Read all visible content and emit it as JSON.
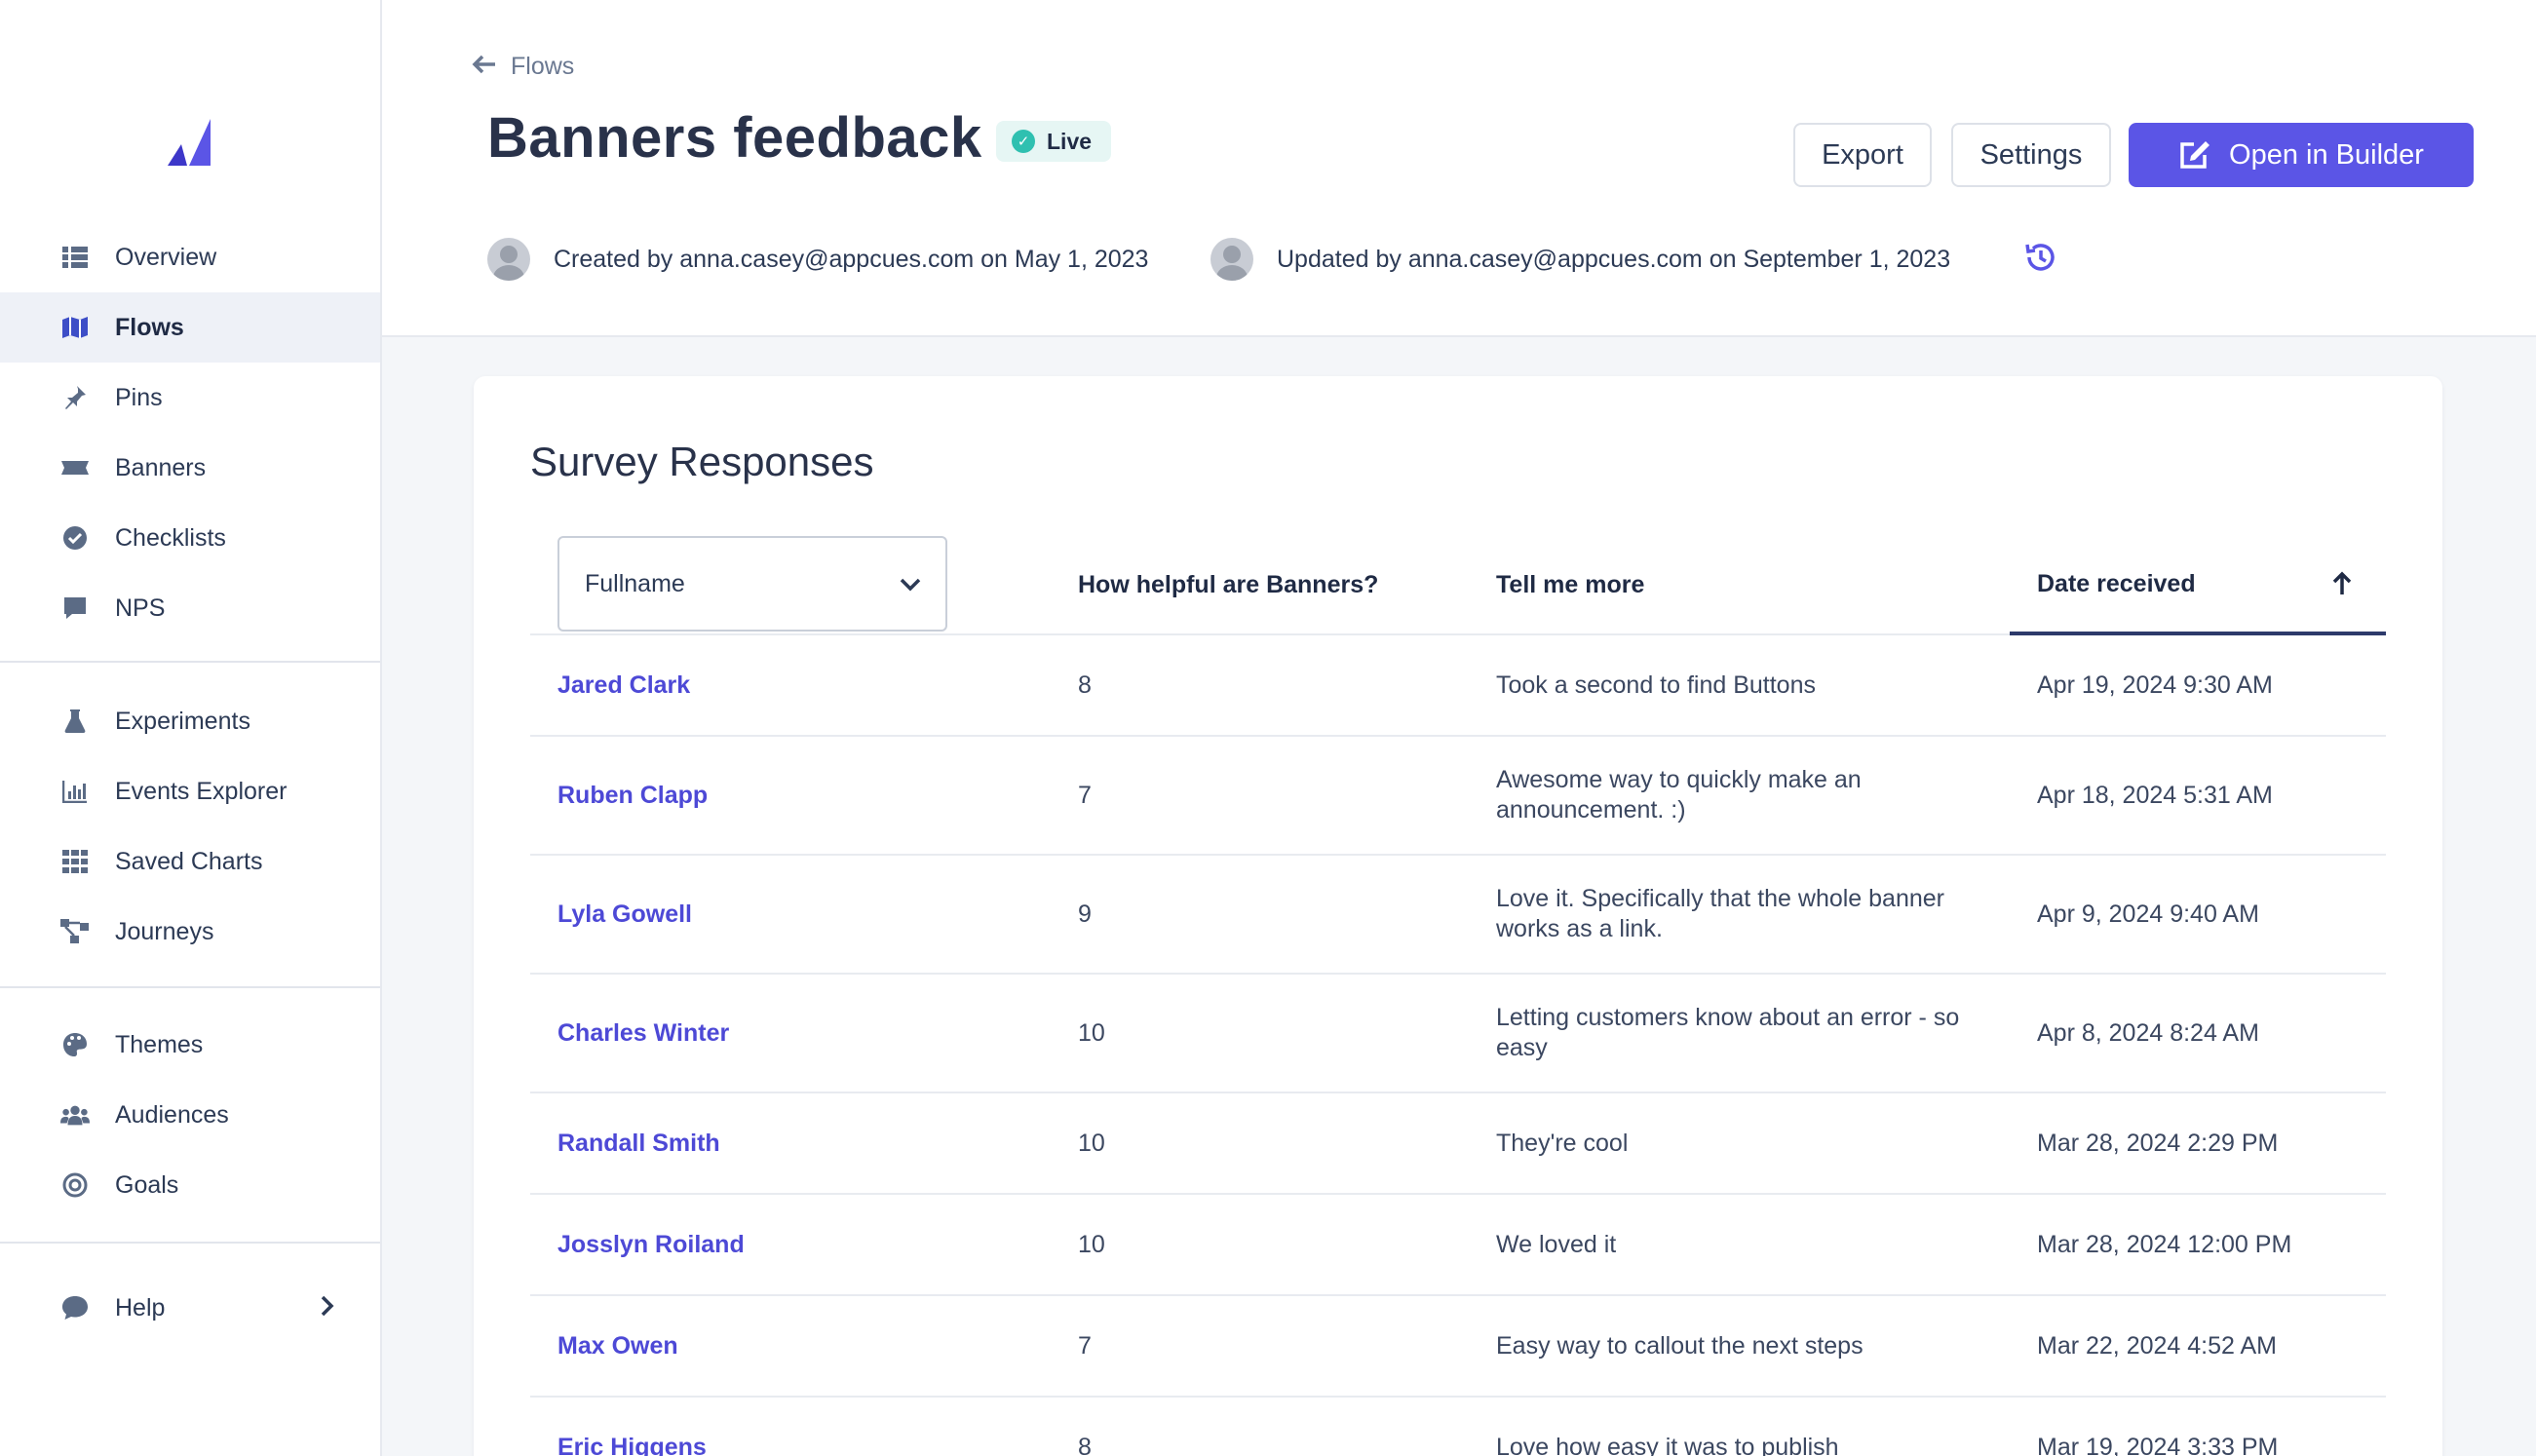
{
  "brand": {
    "accent": "#5b55e6",
    "link": "#4d49d6"
  },
  "sidebar": {
    "groups": [
      [
        {
          "label": "Overview",
          "icon": "list-icon"
        },
        {
          "label": "Flows",
          "icon": "map-icon",
          "active": true
        },
        {
          "label": "Pins",
          "icon": "pin-icon"
        },
        {
          "label": "Banners",
          "icon": "banner-icon"
        },
        {
          "label": "Checklists",
          "icon": "check-circle-icon"
        },
        {
          "label": "NPS",
          "icon": "chat-icon"
        }
      ],
      [
        {
          "label": "Experiments",
          "icon": "flask-icon"
        },
        {
          "label": "Events Explorer",
          "icon": "bar-chart-icon"
        },
        {
          "label": "Saved Charts",
          "icon": "grid-icon"
        },
        {
          "label": "Journeys",
          "icon": "journey-icon"
        }
      ],
      [
        {
          "label": "Themes",
          "icon": "palette-icon"
        },
        {
          "label": "Audiences",
          "icon": "users-icon"
        },
        {
          "label": "Goals",
          "icon": "target-icon"
        }
      ]
    ],
    "help": {
      "label": "Help",
      "icon": "comment-icon"
    }
  },
  "header": {
    "breadcrumb": "Flows",
    "title": "Banners feedback",
    "status": "Live",
    "export_label": "Export",
    "settings_label": "Settings",
    "builder_label": "Open in Builder",
    "created": "Created by anna.casey@appcues.com on May 1, 2023",
    "updated": "Updated by anna.casey@appcues.com on September 1, 2023"
  },
  "survey": {
    "title": "Survey Responses",
    "filter_value": "Fullname",
    "columns": {
      "score": "How helpful are Banners?",
      "more": "Tell me more",
      "date": "Date received"
    },
    "rows": [
      {
        "name": "Jared Clark",
        "score": "8",
        "more": "Took a second to find Buttons",
        "date": "Apr 19, 2024 9:30 AM"
      },
      {
        "name": "Ruben Clapp",
        "score": "7",
        "more": "Awesome way to quickly make an announcement. :)",
        "date": "Apr 18, 2024 5:31 AM"
      },
      {
        "name": "Lyla Gowell",
        "score": "9",
        "more": "Love it. Specifically that the whole banner works as a link.",
        "date": "Apr 9, 2024 9:40 AM"
      },
      {
        "name": "Charles Winter",
        "score": "10",
        "more": "Letting customers know about an error - so easy",
        "date": "Apr 8, 2024 8:24 AM"
      },
      {
        "name": "Randall Smith",
        "score": "10",
        "more": "They're cool",
        "date": "Mar 28, 2024 2:29 PM"
      },
      {
        "name": "Josslyn Roiland",
        "score": "10",
        "more": "We loved it",
        "date": "Mar 28, 2024 12:00 PM"
      },
      {
        "name": "Max Owen",
        "score": "7",
        "more": "Easy way to callout the next steps",
        "date": "Mar 22, 2024 4:52 AM"
      },
      {
        "name": "Eric Higgens",
        "score": "8",
        "more": "Love how easy it was to publish",
        "date": "Mar 19, 2024 3:33 PM"
      }
    ]
  }
}
